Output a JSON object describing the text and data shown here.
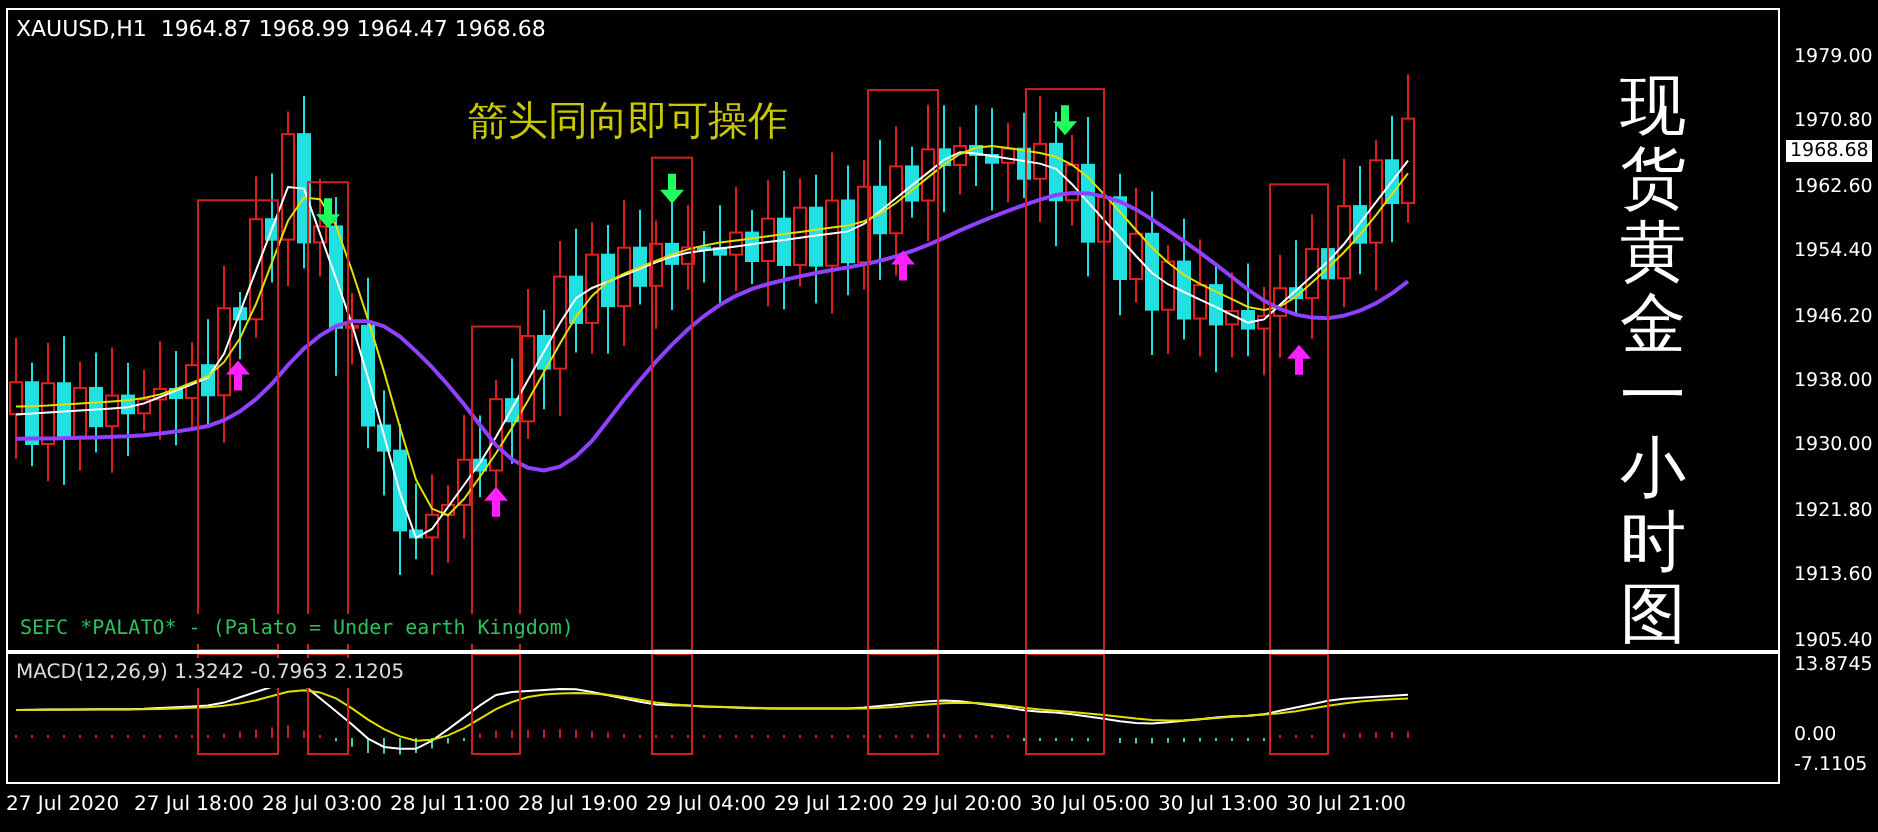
{
  "header": {
    "text": "XAUUSD,H1  1964.87 1968.99 1964.47 1968.68"
  },
  "main_chart": {
    "overlay_text": "箭头同向即可操作",
    "vertical_title": "现货黄金一小时图",
    "indicator_caption": "SEFC *PALATO* - (Palato = Under earth Kingdom)"
  },
  "price_axis": {
    "ticks": [
      "1979.00",
      "1970.80",
      "1962.60",
      "1954.40",
      "1946.20",
      "1938.00",
      "1930.00",
      "1921.80",
      "1913.60",
      "1905.40"
    ],
    "current_price": "1968.68"
  },
  "macd_panel": {
    "label": "MACD(12,26,9) 1.3242 -0.7963 2.1205",
    "ticks": [
      "13.8745",
      "0.00",
      "-7.1105"
    ]
  },
  "time_axis": {
    "ticks": [
      "27 Jul 2020",
      "27 Jul 18:00",
      "28 Jul 03:00",
      "28 Jul 11:00",
      "28 Jul 19:00",
      "29 Jul 04:00",
      "29 Jul 12:00",
      "29 Jul 20:00",
      "30 Jul 05:00",
      "30 Jul 13:00",
      "30 Jul 21:00"
    ]
  }
}
